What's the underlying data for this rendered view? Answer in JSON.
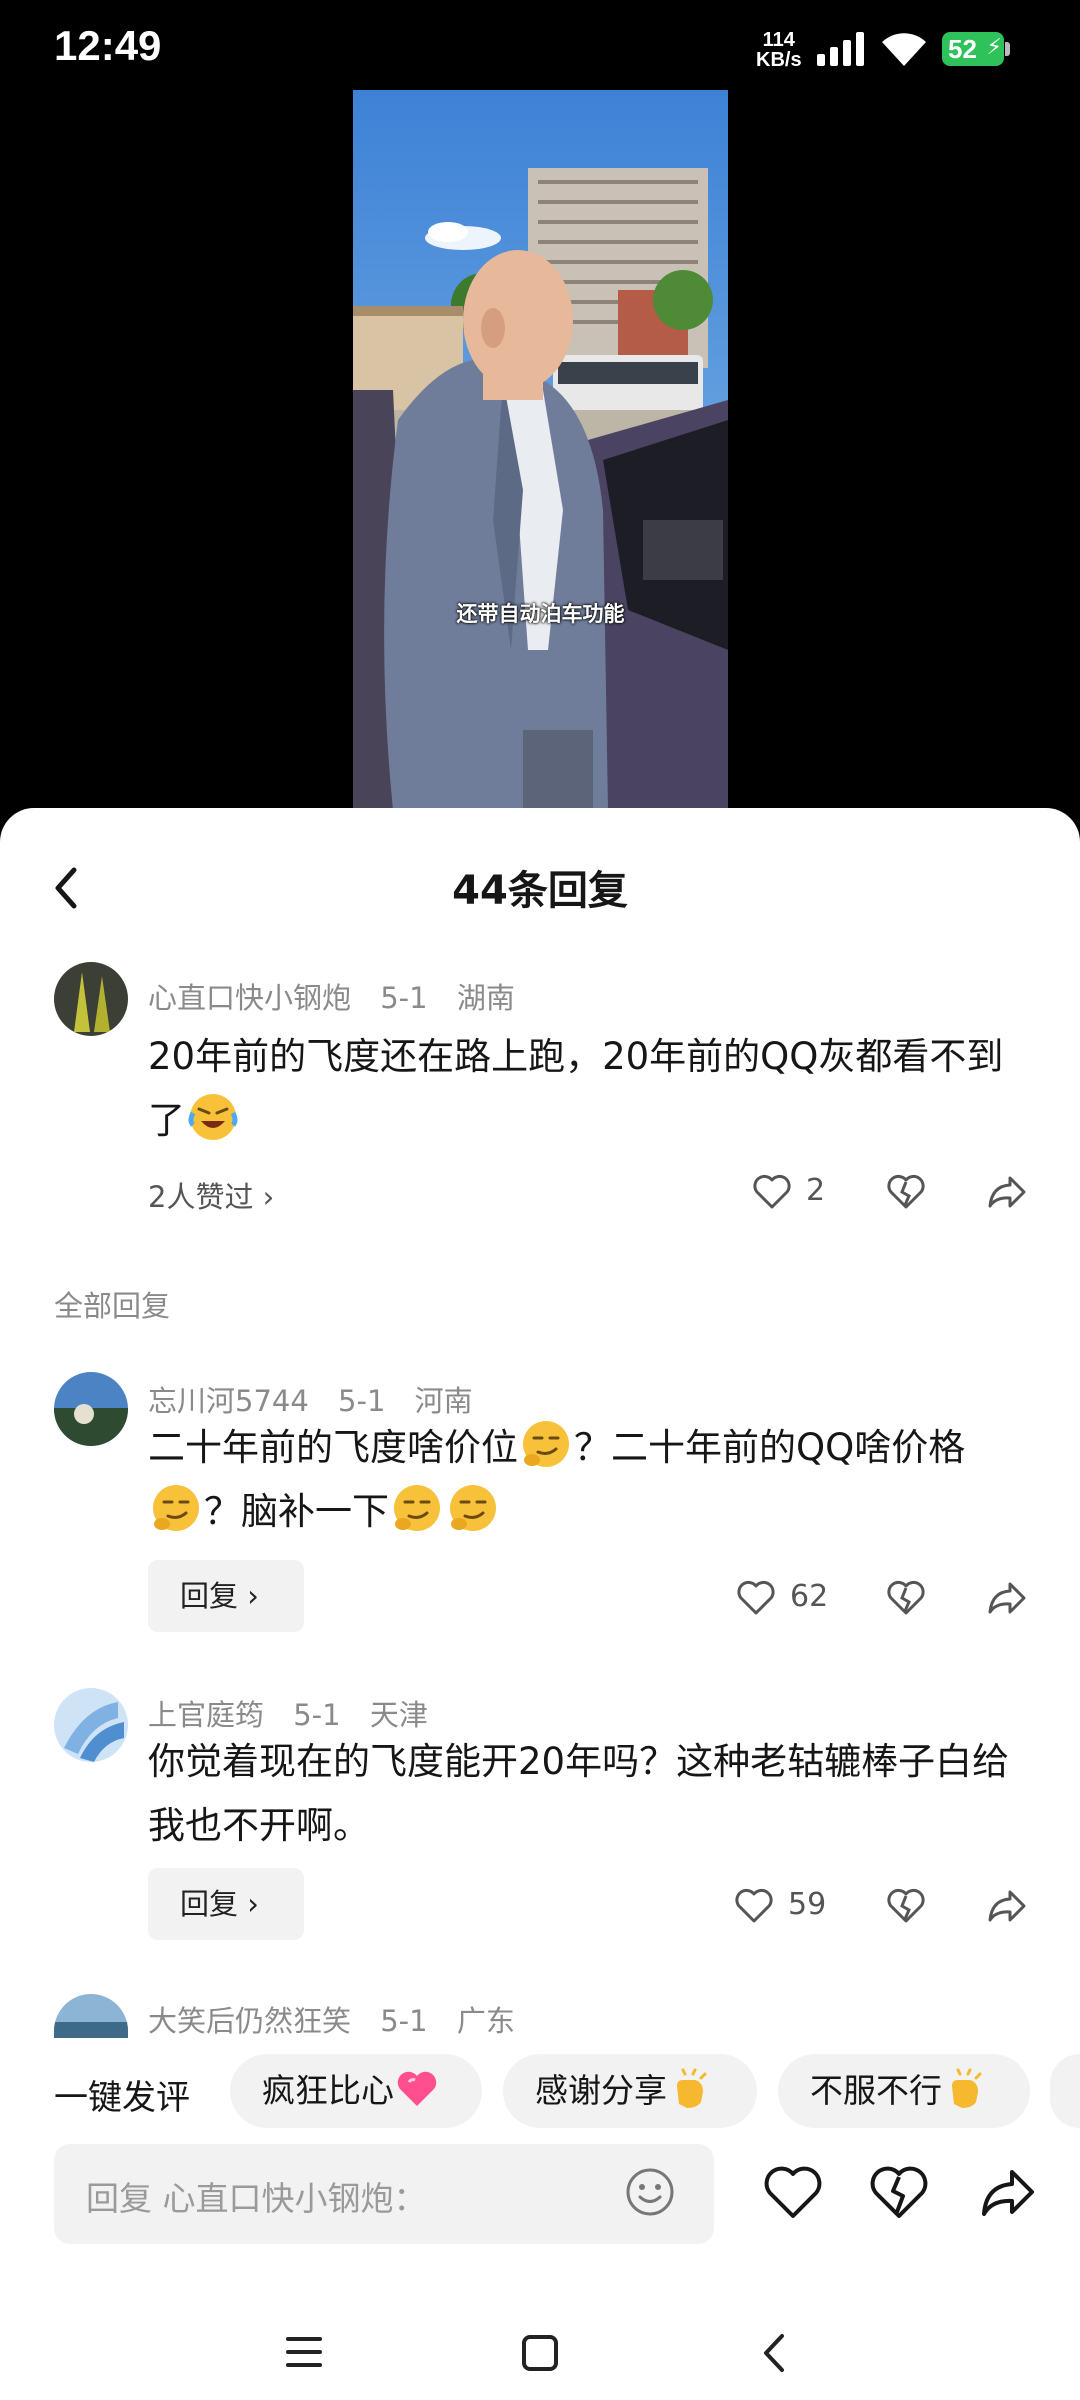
{
  "status": {
    "time": "12:49",
    "net_speed": "114",
    "net_unit": "KB/s",
    "battery": "52"
  },
  "video": {
    "caption": "还带自动泊车功能"
  },
  "sheet": {
    "title": "44条回复",
    "section_label": "全部回复"
  },
  "main_comment": {
    "user": "心直口快小钢炮",
    "date": "5-1",
    "location": "湖南",
    "text": "20年前的飞度还在路上跑，20年前的QQ灰都看不到了",
    "liked_by": "2人赞过 ›",
    "like_count": "2"
  },
  "replies": [
    {
      "user": "忘川河5744",
      "date": "5-1",
      "location": "河南",
      "text_parts": [
        "二十年前的飞度啥价位",
        "？二十年前的QQ啥价格",
        "？脑补一下"
      ],
      "reply_label": "回复 ›",
      "like_count": "62"
    },
    {
      "user": "上官庭筠",
      "date": "5-1",
      "location": "天津",
      "text": "你觉着现在的飞度能开20年吗？这种老轱辘棒子白给我也不开啊。",
      "reply_label": "回复 ›",
      "like_count": "59"
    },
    {
      "user": "大笑后仍然狂笑",
      "date": "5-1",
      "location": "广东"
    }
  ],
  "quick_reply": {
    "label": "一键发评",
    "chips": [
      {
        "label": "疯狂比心",
        "emoji": "heart-emoji"
      },
      {
        "label": "感谢分享",
        "emoji": "clap-emoji"
      },
      {
        "label": "不服不行",
        "emoji": "clap-emoji"
      }
    ]
  },
  "input": {
    "placeholder": "回复 心直口快小钢炮："
  },
  "colors": {
    "accent_green": "#2fc25b",
    "text_primary": "#161616",
    "text_secondary": "#8a8a8a",
    "chip_bg": "#f2f2f2"
  }
}
